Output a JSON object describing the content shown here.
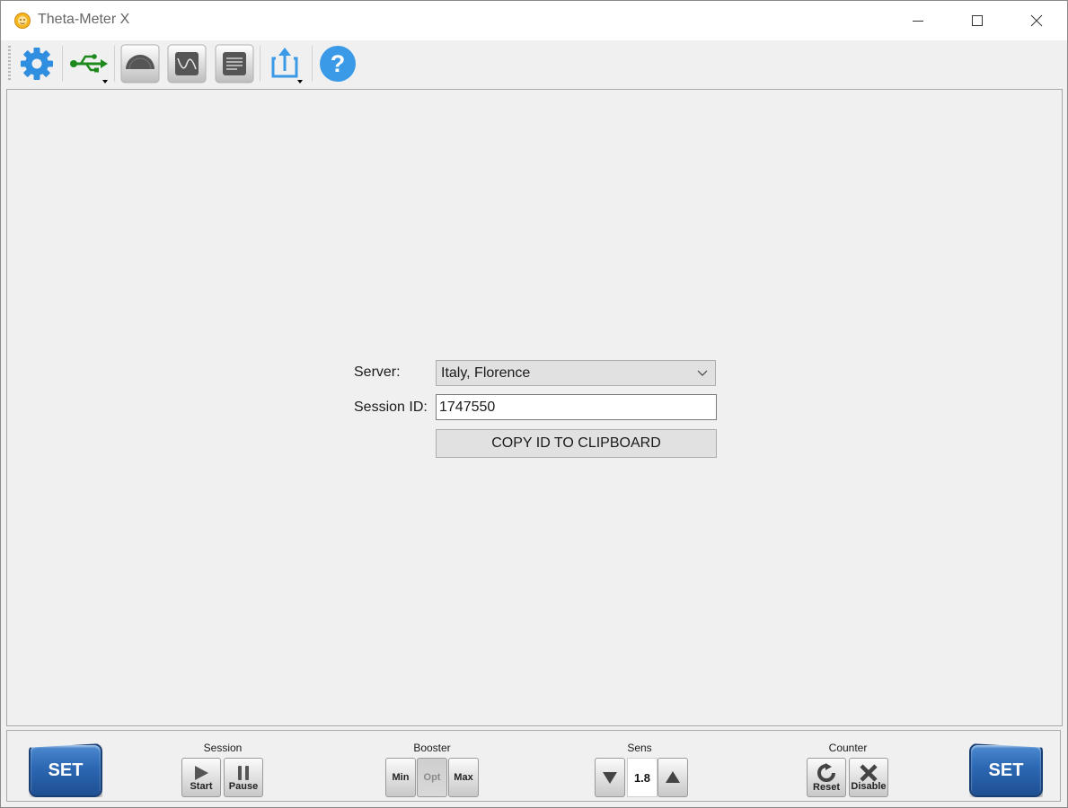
{
  "window": {
    "title": "Theta-Meter X",
    "controls": {
      "minimize": "minimize",
      "maximize": "maximize",
      "close": "close"
    }
  },
  "toolbar": {
    "items": [
      {
        "id": "settings",
        "icon": "gear-icon",
        "color": "#2f8ee0"
      },
      {
        "id": "usb",
        "icon": "usb-icon",
        "color": "#1e8a1e",
        "has_dropdown": true
      },
      {
        "id": "meter",
        "icon": "gauge-icon"
      },
      {
        "id": "graph",
        "icon": "waveform-icon"
      },
      {
        "id": "log",
        "icon": "list-icon"
      },
      {
        "id": "export",
        "icon": "upload-icon",
        "color": "#3a9ae8",
        "has_dropdown": true
      },
      {
        "id": "help",
        "icon": "help-icon",
        "color": "#3a9ae8"
      }
    ]
  },
  "form": {
    "server_label": "Server:",
    "server_value": "Italy, Florence",
    "session_label": "Session ID:",
    "session_value": "1747550",
    "copy_button": "COPY ID TO CLIPBOARD"
  },
  "controls": {
    "set_left": "SET",
    "set_right": "SET",
    "session": {
      "title": "Session",
      "start": "Start",
      "pause": "Pause"
    },
    "booster": {
      "title": "Booster",
      "min": "Min",
      "opt": "Opt",
      "max": "Max",
      "selected": "Opt"
    },
    "sens": {
      "title": "Sens",
      "value": "1.8"
    },
    "counter": {
      "title": "Counter",
      "reset": "Reset",
      "disable": "Disable"
    }
  },
  "colors": {
    "set_button": "#2c67b3",
    "usb_green": "#1e8a1e",
    "toolbar_blue": "#2f8ee0"
  }
}
